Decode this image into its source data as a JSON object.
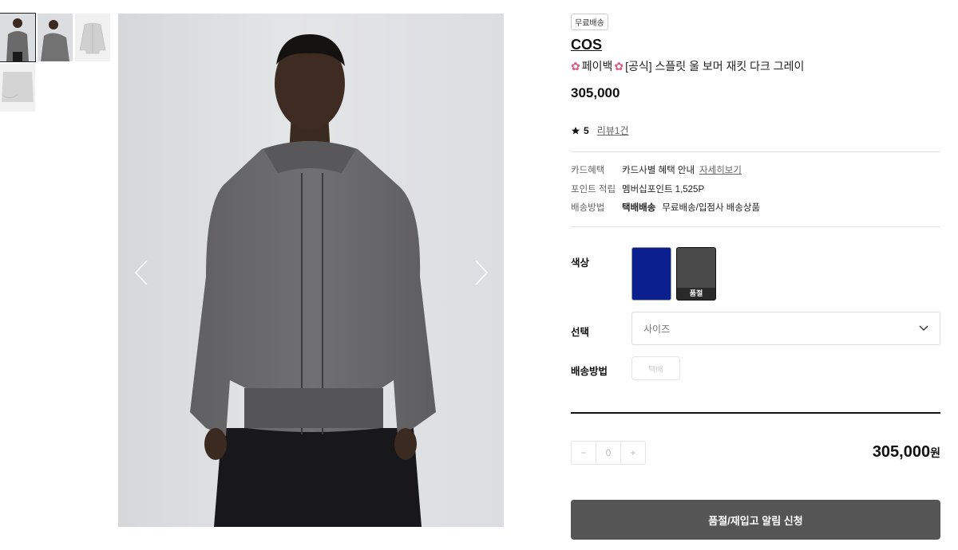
{
  "badge": "무료배송",
  "brand": "COS",
  "title": {
    "flower_icon": "flower-icon",
    "payback": "페이백",
    "name": "[공식] 스플릿 울 보머 재킷 다크 그레이"
  },
  "price": "305,000",
  "rating": {
    "score": "5",
    "review_link": "리뷰1건"
  },
  "info": [
    {
      "key": "카드혜택",
      "value": "카드사별 혜택 안내",
      "link": "자세히보기"
    },
    {
      "key": "포인트 적립",
      "value": "멤버십포인트 1,525P"
    },
    {
      "key": "배송방법",
      "bold": "택배배송",
      "value": "무료배송/입점사 배송상품"
    }
  ],
  "options": {
    "color_label": "색상",
    "swatches": [
      {
        "name": "blue",
        "color": "#0b1f8f"
      },
      {
        "name": "dark-gray",
        "color": "#4a4a4a",
        "soldout": "품절"
      }
    ],
    "select_label": "선택",
    "size_placeholder": "사이즈",
    "shipping_label": "배송방법",
    "shipping_option": "택배"
  },
  "quantity": {
    "minus": "−",
    "value": "0",
    "plus": "+"
  },
  "total": {
    "amount": "305,000",
    "unit": "원"
  },
  "cta": "품절/재입고 알림 신청",
  "colors": {
    "accent": "#555555",
    "flower": "#e0587f"
  }
}
